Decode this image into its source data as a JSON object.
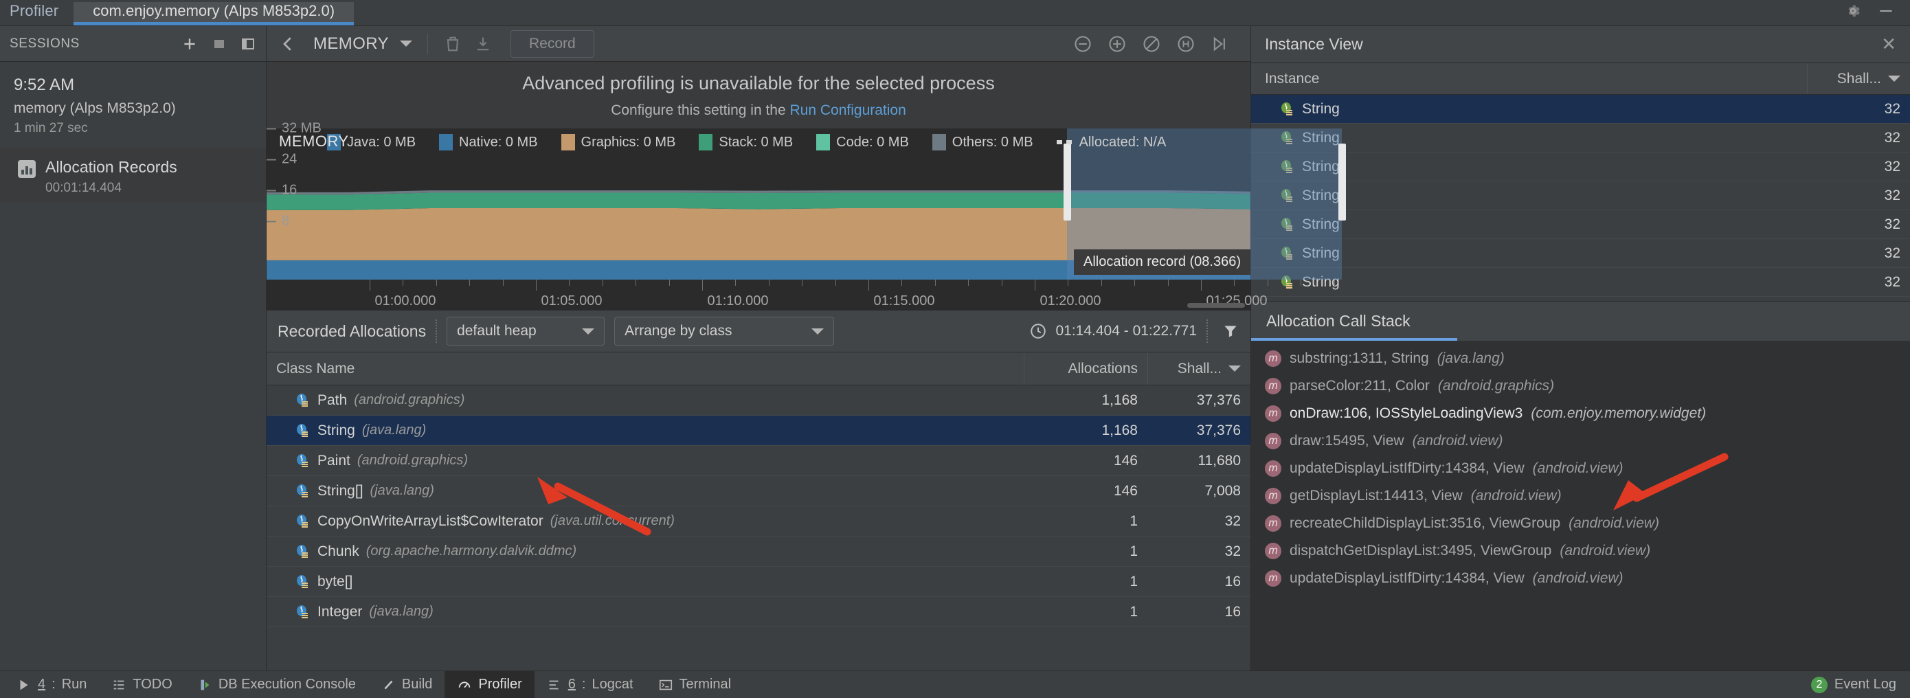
{
  "topbar": {
    "title": "Profiler",
    "tab_label": "com.enjoy.memory (Alps M853p2.0)",
    "accent": "#4a88c7"
  },
  "sessions": {
    "header": "SESSIONS",
    "time": "9:52 AM",
    "process": "memory (Alps M853p2.0)",
    "duration": "1 min 27 sec",
    "record_label": "Allocation Records",
    "record_time": "00:01:14.404"
  },
  "memory_toolbar": {
    "stage_label": "MEMORY",
    "record_button": "Record"
  },
  "banner": {
    "line1": "Advanced profiling is unavailable for the selected process",
    "line2_prefix": "Configure this setting in the ",
    "line2_link": "Run Configuration"
  },
  "chart_data": {
    "type": "area",
    "title": "MEMORY",
    "xlabel": "",
    "ylabel": "MB",
    "ylim": [
      0,
      32
    ],
    "yticks": [
      "32 MB",
      "24",
      "16",
      "8"
    ],
    "ytick_values": [
      32,
      24,
      16,
      8
    ],
    "xticks": [
      "01:00.000",
      "01:05.000",
      "01:10.000",
      "01:15.000",
      "01:20.000",
      "01:25.000"
    ],
    "grid": false,
    "legend_position": "top",
    "legend": [
      {
        "name": "Java: 0 MB",
        "color": "#3a77a5"
      },
      {
        "name": "Native: 0 MB",
        "color": "#3a77a5"
      },
      {
        "name": "Graphics: 0 MB",
        "color": "#c49a6c"
      },
      {
        "name": "Stack: 0 MB",
        "color": "#3d9e79"
      },
      {
        "name": "Code: 0 MB",
        "color": "#5fc2a0"
      },
      {
        "name": "Others: 0 MB",
        "color": "#6e7b85"
      },
      {
        "name": "Allocated: N/A",
        "color": "#d8d8d8"
      }
    ],
    "series": [
      {
        "name": "Java",
        "color": "#3a77a5",
        "values": [
          5,
          5,
          5,
          5,
          5,
          5,
          5,
          5,
          5,
          5,
          5,
          5,
          5
        ]
      },
      {
        "name": "Native",
        "color": "#c49a6c",
        "values": [
          13,
          13,
          13.5,
          13.5,
          13.5,
          13.5,
          13.2,
          13.5,
          13.5,
          13.5,
          13.5,
          13.5,
          13.2
        ]
      },
      {
        "name": "Graphics",
        "color": "#3d9e79",
        "values": [
          4,
          4,
          4,
          4,
          4,
          4,
          4.2,
          4,
          4,
          4,
          4,
          4,
          4
        ]
      },
      {
        "name": "Others",
        "color": "#6e7b85",
        "values": [
          0.6,
          0.6,
          0.6,
          0.6,
          0.6,
          0.6,
          0.6,
          0.6,
          0.6,
          0.6,
          0.6,
          0.6,
          0.6
        ]
      }
    ],
    "tooltip": "Allocation record (08.366)",
    "selection_range": "01:14.404 - 01:22.771"
  },
  "allocations_toolbar": {
    "title": "Recorded Allocations",
    "heap_select": "default heap",
    "arrange_select": "Arrange by class",
    "time_range": "01:14.404 - 01:22.771"
  },
  "class_table": {
    "columns": [
      "Class Name",
      "Allocations",
      "Shall..."
    ],
    "rows": [
      {
        "name": "Path",
        "pkg": "(android.graphics)",
        "allocations": "1,168",
        "shallow": "37,376",
        "selected": false
      },
      {
        "name": "String",
        "pkg": "(java.lang)",
        "allocations": "1,168",
        "shallow": "37,376",
        "selected": true
      },
      {
        "name": "Paint",
        "pkg": "(android.graphics)",
        "allocations": "146",
        "shallow": "11,680",
        "selected": false
      },
      {
        "name": "String[]",
        "pkg": "(java.lang)",
        "allocations": "146",
        "shallow": "7,008",
        "selected": false
      },
      {
        "name": "CopyOnWriteArrayList$CowIterator",
        "pkg": "(java.util.concurrent)",
        "allocations": "1",
        "shallow": "32",
        "selected": false
      },
      {
        "name": "Chunk",
        "pkg": "(org.apache.harmony.dalvik.ddmc)",
        "allocations": "1",
        "shallow": "32",
        "selected": false
      },
      {
        "name": "byte[]",
        "pkg": "",
        "allocations": "1",
        "shallow": "16",
        "selected": false
      },
      {
        "name": "Integer",
        "pkg": "(java.lang)",
        "allocations": "1",
        "shallow": "16",
        "selected": false
      }
    ]
  },
  "instance_view": {
    "title": "Instance View",
    "columns": [
      "Instance",
      "Shall..."
    ],
    "rows": [
      {
        "name": "String",
        "shallow": "32",
        "selected": true
      },
      {
        "name": "String",
        "shallow": "32",
        "selected": false
      },
      {
        "name": "String",
        "shallow": "32",
        "selected": false
      },
      {
        "name": "String",
        "shallow": "32",
        "selected": false
      },
      {
        "name": "String",
        "shallow": "32",
        "selected": false
      },
      {
        "name": "String",
        "shallow": "32",
        "selected": false
      },
      {
        "name": "String",
        "shallow": "32",
        "selected": false
      }
    ]
  },
  "call_stack": {
    "tab_label": "Allocation Call Stack",
    "frames": [
      {
        "method": "substring:1311, String",
        "pkg": "(java.lang)",
        "highlight": false
      },
      {
        "method": "parseColor:211, Color",
        "pkg": "(android.graphics)",
        "highlight": false
      },
      {
        "method": "onDraw:106, IOSStyleLoadingView3",
        "pkg": "(com.enjoy.memory.widget)",
        "highlight": true
      },
      {
        "method": "draw:15495, View",
        "pkg": "(android.view)",
        "highlight": false
      },
      {
        "method": "updateDisplayListIfDirty:14384, View",
        "pkg": "(android.view)",
        "highlight": false
      },
      {
        "method": "getDisplayList:14413, View",
        "pkg": "(android.view)",
        "highlight": false
      },
      {
        "method": "recreateChildDisplayList:3516, ViewGroup",
        "pkg": "(android.view)",
        "highlight": false
      },
      {
        "method": "dispatchGetDisplayList:3495, ViewGroup",
        "pkg": "(android.view)",
        "highlight": false
      },
      {
        "method": "updateDisplayListIfDirty:14384, View",
        "pkg": "(android.view)",
        "highlight": false
      }
    ]
  },
  "statusbar": {
    "items": [
      {
        "label": "4: Run",
        "icon": "play-icon"
      },
      {
        "label": "TODO",
        "icon": "list-icon"
      },
      {
        "label": "DB Execution Console",
        "icon": "database-icon"
      },
      {
        "label": "Build",
        "icon": "hammer-icon"
      },
      {
        "label": "Profiler",
        "icon": "profiler-icon"
      },
      {
        "label": "6: Logcat",
        "icon": "logcat-icon"
      },
      {
        "label": "Terminal",
        "icon": "terminal-icon"
      }
    ],
    "active": "Profiler",
    "event_log": "Event Log",
    "event_count": "2"
  }
}
